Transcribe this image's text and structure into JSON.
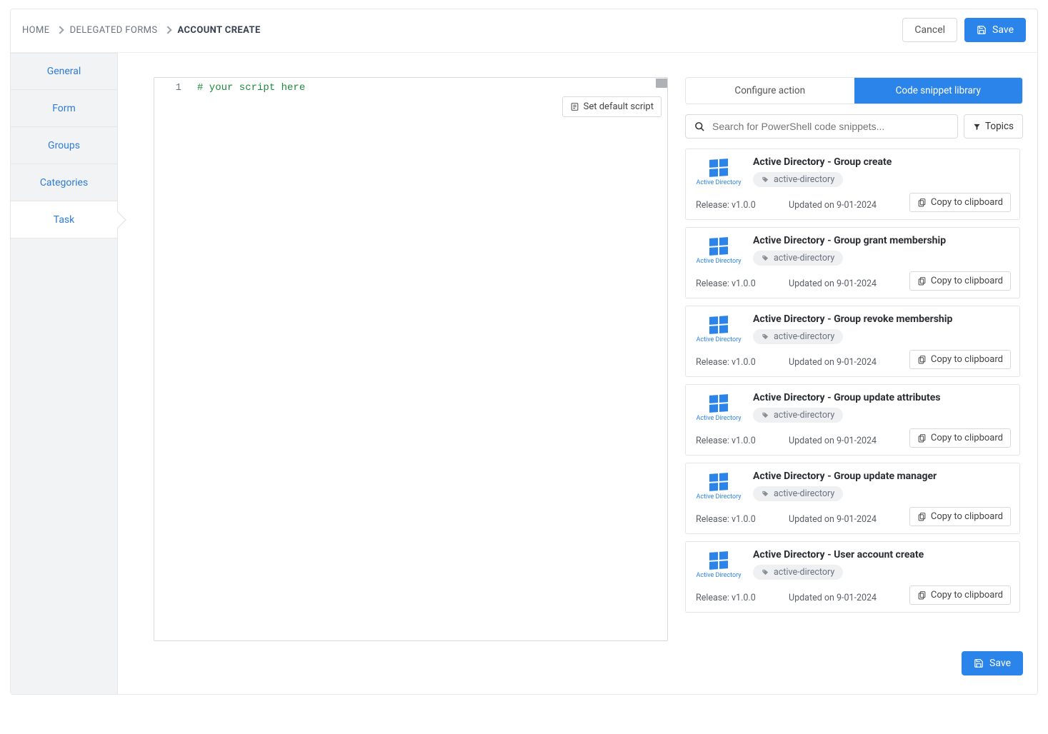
{
  "breadcrumb": {
    "home": "Home",
    "delegated": "Delegated Forms",
    "current": "Account Create"
  },
  "header": {
    "cancel": "Cancel",
    "save": "Save"
  },
  "sidebar": {
    "items": [
      {
        "label": "General"
      },
      {
        "label": "Form"
      },
      {
        "label": "Groups"
      },
      {
        "label": "Categories"
      },
      {
        "label": "Task"
      }
    ],
    "activeIndex": 4
  },
  "editor": {
    "line1_no": "1",
    "line1_text": "# your script here",
    "set_default": "Set default script"
  },
  "snippet_panel": {
    "tab_configure": "Configure action",
    "tab_library": "Code snippet library",
    "search_placeholder": "Search for PowerShell code snippets...",
    "topics_label": "Topics",
    "copy_label": "Copy to clipboard",
    "logo_text": "Active Directory",
    "snippets": [
      {
        "title": "Active Directory - Group create",
        "tag": "active-directory",
        "release": "Release: v1.0.0",
        "updated": "Updated on 9-01-2024"
      },
      {
        "title": "Active Directory - Group grant membership",
        "tag": "active-directory",
        "release": "Release: v1.0.0",
        "updated": "Updated on 9-01-2024"
      },
      {
        "title": "Active Directory - Group revoke membership",
        "tag": "active-directory",
        "release": "Release: v1.0.0",
        "updated": "Updated on 9-01-2024"
      },
      {
        "title": "Active Directory - Group update attributes",
        "tag": "active-directory",
        "release": "Release: v1.0.0",
        "updated": "Updated on 9-01-2024"
      },
      {
        "title": "Active Directory - Group update manager",
        "tag": "active-directory",
        "release": "Release: v1.0.0",
        "updated": "Updated on 9-01-2024"
      },
      {
        "title": "Active Directory - User account create",
        "tag": "active-directory",
        "release": "Release: v1.0.0",
        "updated": "Updated on 9-01-2024"
      }
    ]
  },
  "footer": {
    "save": "Save"
  }
}
